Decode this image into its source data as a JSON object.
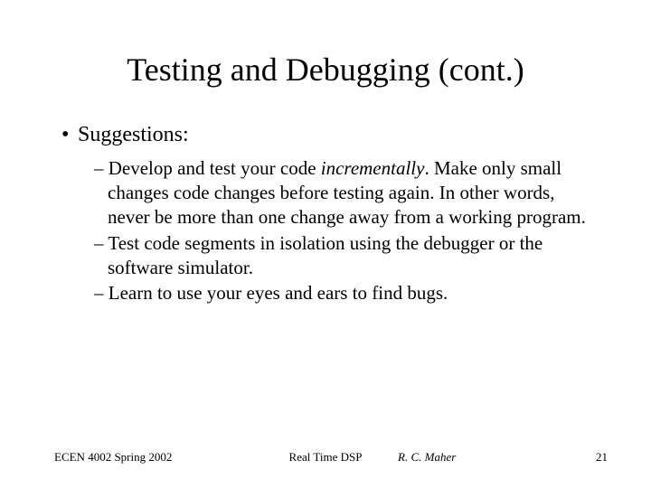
{
  "title": "Testing and Debugging (cont.)",
  "heading": "Suggestions:",
  "bullets": {
    "b1_pre": "Develop and test your code ",
    "b1_em": "incrementally",
    "b1_post": ". Make only small changes code changes before testing again.  In other words, never be more than one change away from a working program.",
    "b2": "Test code segments in isolation using the debugger or the software simulator.",
    "b3": "Learn to use your eyes and ears to find bugs."
  },
  "footer": {
    "left": "ECEN 4002 Spring 2002",
    "center": "Real Time DSP",
    "author": "R. C. Maher",
    "page": "21"
  }
}
